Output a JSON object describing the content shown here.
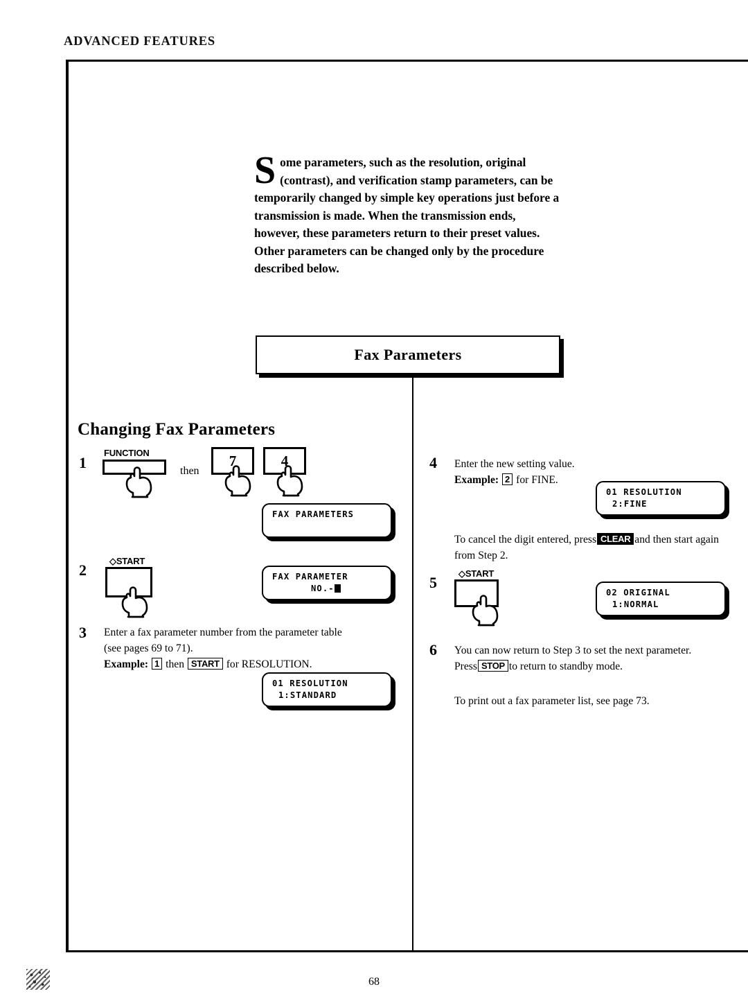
{
  "header": {
    "running_title": "ADVANCED FEATURES"
  },
  "intro": {
    "dropcap": "S",
    "text": "ome parameters, such as the resolution, original (contrast), and verification stamp parameters, can be temporarily changed by simple key operations just before a transmission is made. When the transmission ends, however, these parameters return to their preset values.  Other parameters can be changed only by the procedure described below."
  },
  "title_box": {
    "label": "Fax Parameters"
  },
  "section": {
    "heading": "Changing Fax Parameters"
  },
  "steps": {
    "s1": {
      "number": "1",
      "function_key_label": "FUNCTION",
      "then_word": "then",
      "key_7": "7",
      "key_4": "4",
      "lcd": {
        "line1": "FAX PARAMETERS",
        "line2": ""
      }
    },
    "s2": {
      "number": "2",
      "start_key_label": "START",
      "start_key_glyph": "◇",
      "lcd": {
        "line1": "FAX PARAMETER",
        "line2": "NO.-"
      }
    },
    "s3": {
      "number": "3",
      "line1": "Enter a fax parameter number from the parameter table",
      "line2": "(see pages 69 to 71).",
      "example_label": "Example:",
      "example_key1": "1",
      "example_then": "then",
      "example_key2": "START",
      "example_tail": "for RESOLUTION.",
      "lcd": {
        "line1": "01 RESOLUTION",
        "line2": "1:STANDARD"
      }
    },
    "s4": {
      "number": "4",
      "line1": "Enter the new setting value.",
      "example_label": "Example:",
      "example_key": "2",
      "example_tail": "for FINE.",
      "lcd": {
        "line1": "01 RESOLUTION",
        "line2": "2:FINE"
      },
      "note_pre": "To cancel the digit entered, press",
      "note_key": "CLEAR",
      "note_post": "and then start again from Step 2."
    },
    "s5": {
      "number": "5",
      "start_key_label": "START",
      "start_key_glyph": "◇",
      "lcd": {
        "line1": "02 ORIGINAL",
        "line2": "1:NORMAL"
      }
    },
    "s6": {
      "number": "6",
      "line1": "You can now return to Step 3 to set the next parameter.",
      "line2_pre": "Press",
      "line2_key": "STOP",
      "line2_post": "to return to standby mode."
    }
  },
  "closing_note": "To print out a fax parameter list, see page 73.",
  "footer": {
    "page_number": "68"
  }
}
